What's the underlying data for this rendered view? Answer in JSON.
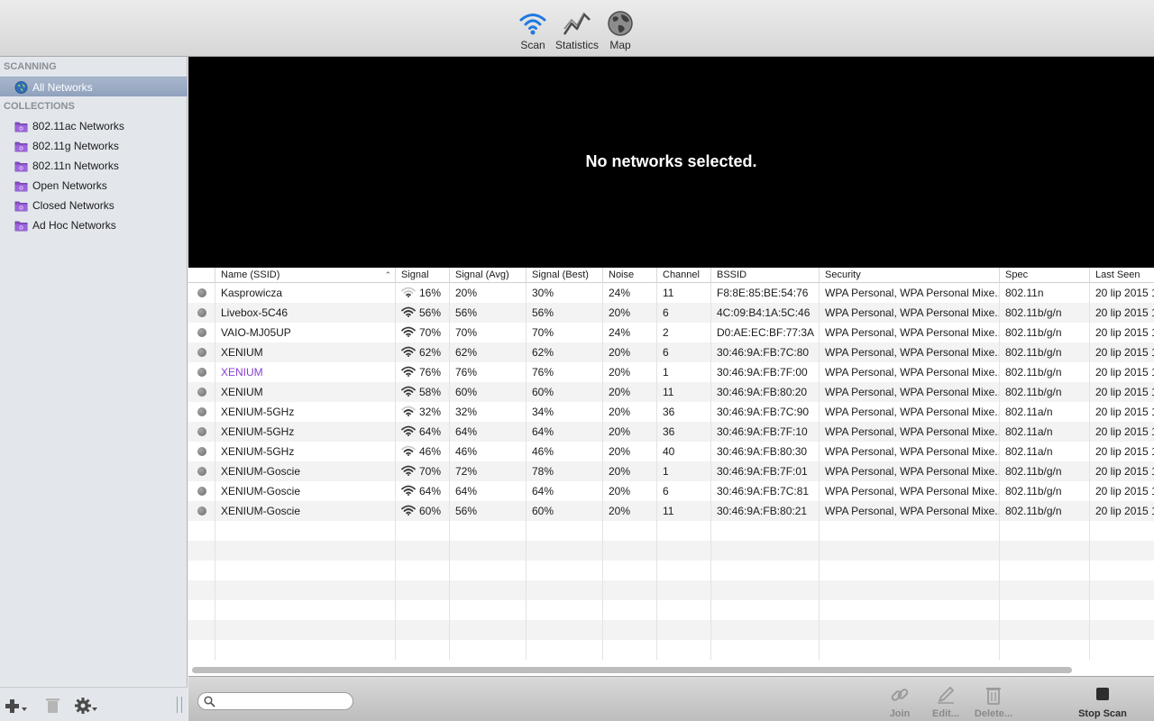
{
  "toolbar": {
    "buttons": [
      {
        "label": "Scan",
        "icon": "wifi-icon",
        "color": "#1f7ae0"
      },
      {
        "label": "Statistics",
        "icon": "chart-icon"
      },
      {
        "label": "Map",
        "icon": "globe-icon"
      }
    ]
  },
  "sidebar": {
    "scanning_header": "SCANNING",
    "all_networks": "All Networks",
    "collections_header": "COLLECTIONS",
    "collections": [
      "802.11ac Networks",
      "802.11g Networks",
      "802.11n Networks",
      "Open Networks",
      "Closed Networks",
      "Ad Hoc Networks"
    ]
  },
  "detail": {
    "message": "No networks selected."
  },
  "table": {
    "columns": [
      "Name (SSID)",
      "Signal",
      "Signal (Avg)",
      "Signal (Best)",
      "Noise",
      "Channel",
      "BSSID",
      "Security",
      "Spec",
      "Last Seen"
    ],
    "rows": [
      {
        "name": "Kasprowicza",
        "signal": "16%",
        "avg": "20%",
        "best": "30%",
        "noise": "24%",
        "channel": "11",
        "bssid": "F8:8E:85:BE:54:76",
        "security": "WPA Personal, WPA Personal Mixe...",
        "spec": "802.11n",
        "last_seen": "20 lip 2015 1",
        "highlight": false
      },
      {
        "name": "Livebox-5C46",
        "signal": "56%",
        "avg": "56%",
        "best": "56%",
        "noise": "20%",
        "channel": "6",
        "bssid": "4C:09:B4:1A:5C:46",
        "security": "WPA Personal, WPA Personal Mixe...",
        "spec": "802.11b/g/n",
        "last_seen": "20 lip 2015 1",
        "highlight": false
      },
      {
        "name": "VAIO-MJ05UP",
        "signal": "70%",
        "avg": "70%",
        "best": "70%",
        "noise": "24%",
        "channel": "2",
        "bssid": "D0:AE:EC:BF:77:3A",
        "security": "WPA Personal, WPA Personal Mixe...",
        "spec": "802.11b/g/n",
        "last_seen": "20 lip 2015 1",
        "highlight": false
      },
      {
        "name": "XENIUM",
        "signal": "62%",
        "avg": "62%",
        "best": "62%",
        "noise": "20%",
        "channel": "6",
        "bssid": "30:46:9A:FB:7C:80",
        "security": "WPA Personal, WPA Personal Mixe...",
        "spec": "802.11b/g/n",
        "last_seen": "20 lip 2015 1",
        "highlight": false
      },
      {
        "name": "XENIUM",
        "signal": "76%",
        "avg": "76%",
        "best": "76%",
        "noise": "20%",
        "channel": "1",
        "bssid": "30:46:9A:FB:7F:00",
        "security": "WPA Personal, WPA Personal Mixe...",
        "spec": "802.11b/g/n",
        "last_seen": "20 lip 2015 1",
        "highlight": true
      },
      {
        "name": "XENIUM",
        "signal": "58%",
        "avg": "60%",
        "best": "60%",
        "noise": "20%",
        "channel": "11",
        "bssid": "30:46:9A:FB:80:20",
        "security": "WPA Personal, WPA Personal Mixe...",
        "spec": "802.11b/g/n",
        "last_seen": "20 lip 2015 1",
        "highlight": false
      },
      {
        "name": "XENIUM-5GHz",
        "signal": "32%",
        "avg": "32%",
        "best": "34%",
        "noise": "20%",
        "channel": "36",
        "bssid": "30:46:9A:FB:7C:90",
        "security": "WPA Personal, WPA Personal Mixe...",
        "spec": "802.11a/n",
        "last_seen": "20 lip 2015 1",
        "highlight": false
      },
      {
        "name": "XENIUM-5GHz",
        "signal": "64%",
        "avg": "64%",
        "best": "64%",
        "noise": "20%",
        "channel": "36",
        "bssid": "30:46:9A:FB:7F:10",
        "security": "WPA Personal, WPA Personal Mixe...",
        "spec": "802.11a/n",
        "last_seen": "20 lip 2015 1",
        "highlight": false
      },
      {
        "name": "XENIUM-5GHz",
        "signal": "46%",
        "avg": "46%",
        "best": "46%",
        "noise": "20%",
        "channel": "40",
        "bssid": "30:46:9A:FB:80:30",
        "security": "WPA Personal, WPA Personal Mixe...",
        "spec": "802.11a/n",
        "last_seen": "20 lip 2015 1",
        "highlight": false
      },
      {
        "name": "XENIUM-Goscie",
        "signal": "70%",
        "avg": "72%",
        "best": "78%",
        "noise": "20%",
        "channel": "1",
        "bssid": "30:46:9A:FB:7F:01",
        "security": "WPA Personal, WPA Personal Mixe...",
        "spec": "802.11b/g/n",
        "last_seen": "20 lip 2015 1",
        "highlight": false
      },
      {
        "name": "XENIUM-Goscie",
        "signal": "64%",
        "avg": "64%",
        "best": "64%",
        "noise": "20%",
        "channel": "6",
        "bssid": "30:46:9A:FB:7C:81",
        "security": "WPA Personal, WPA Personal Mixe...",
        "spec": "802.11b/g/n",
        "last_seen": "20 lip 2015 1",
        "highlight": false
      },
      {
        "name": "XENIUM-Goscie",
        "signal": "60%",
        "avg": "56%",
        "best": "60%",
        "noise": "20%",
        "channel": "11",
        "bssid": "30:46:9A:FB:80:21",
        "security": "WPA Personal, WPA Personal Mixe...",
        "spec": "802.11b/g/n",
        "last_seen": "20 lip 2015 1",
        "highlight": false
      }
    ],
    "empty_rows": 7
  },
  "bottombar": {
    "search_placeholder": "",
    "buttons": [
      {
        "label": "Join",
        "icon": "link-icon",
        "enabled": false
      },
      {
        "label": "Edit...",
        "icon": "pencil-icon",
        "enabled": false
      },
      {
        "label": "Delete...",
        "icon": "trash-icon",
        "enabled": false
      },
      {
        "label": "Stop Scan",
        "icon": "stop-icon",
        "enabled": true
      }
    ]
  }
}
